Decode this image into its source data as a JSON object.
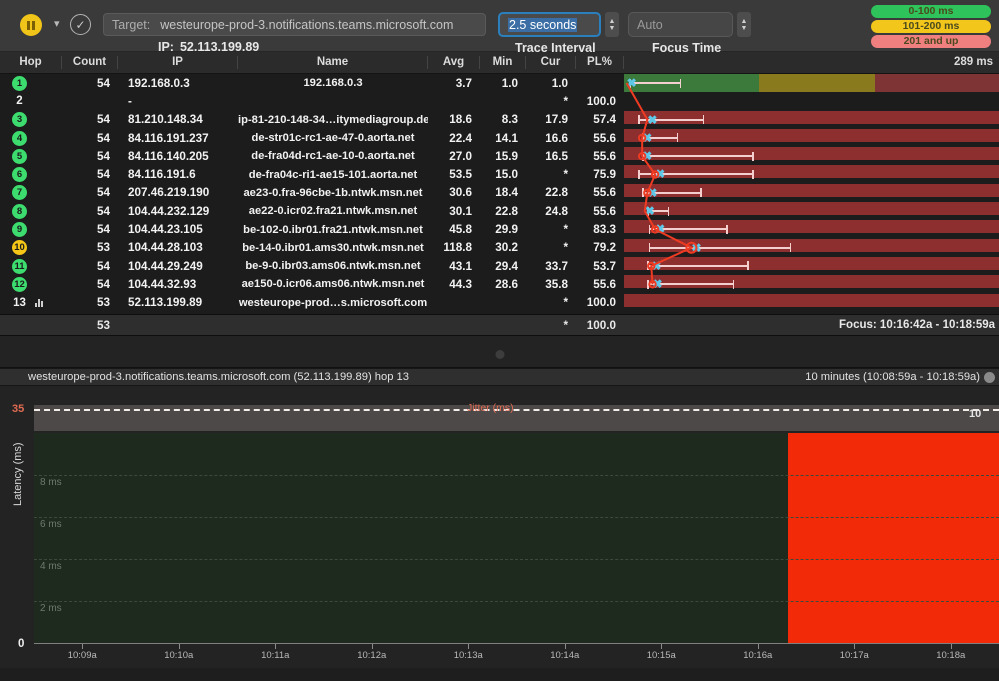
{
  "toolbar": {
    "pause_icon": "pause-icon",
    "chevron_icon": "chevron-down-icon",
    "check_icon": "✓",
    "target_label": "Target:",
    "target_value": "westeurope-prod-3.notifications.teams.microsoft.com",
    "ip_label": "IP:",
    "ip_value": "52.113.199.89",
    "trace_interval_value": "2.5 seconds",
    "trace_interval_caption": "Trace Interval",
    "focus_time_value": "Auto",
    "focus_time_caption": "Focus Time",
    "legend": [
      {
        "label": "0-100 ms",
        "color": "#2fc35c"
      },
      {
        "label": "101-200 ms",
        "color": "#f3c61c"
      },
      {
        "label": "201 and up",
        "color": "#f08080"
      }
    ]
  },
  "table": {
    "headers": {
      "hop": "Hop",
      "count": "Count",
      "ip": "IP",
      "name": "Name",
      "avg": "Avg",
      "min": "Min",
      "cur": "Cur",
      "pl": "PL%",
      "graph_scale": "289 ms"
    },
    "rows": [
      {
        "hop": "1",
        "bubble": "green",
        "count": "54",
        "ip": "192.168.0.3",
        "name": "192.168.0.3",
        "avg": "3.7",
        "min": "1.0",
        "cur": "1.0",
        "pl": ""
      },
      {
        "hop": "2",
        "bubble": "plain",
        "count": "",
        "ip": "-",
        "name": "",
        "avg": "",
        "min": "",
        "cur": "*",
        "pl": "100.0"
      },
      {
        "hop": "3",
        "bubble": "green",
        "count": "54",
        "ip": "81.210.148.34",
        "name": "ip-81-210-148-34…itymediagroup.de",
        "avg": "18.6",
        "min": "8.3",
        "cur": "17.9",
        "pl": "57.4"
      },
      {
        "hop": "4",
        "bubble": "green",
        "count": "54",
        "ip": "84.116.191.237",
        "name": "de-str01c-rc1-ae-47-0.aorta.net",
        "avg": "22.4",
        "min": "14.1",
        "cur": "16.6",
        "pl": "55.6"
      },
      {
        "hop": "5",
        "bubble": "green",
        "count": "54",
        "ip": "84.116.140.205",
        "name": "de-fra04d-rc1-ae-10-0.aorta.net",
        "avg": "27.0",
        "min": "15.9",
        "cur": "16.5",
        "pl": "55.6"
      },
      {
        "hop": "6",
        "bubble": "green",
        "count": "54",
        "ip": "84.116.191.6",
        "name": "de-fra04c-ri1-ae15-101.aorta.net",
        "avg": "53.5",
        "min": "15.0",
        "cur": "*",
        "pl": "75.9"
      },
      {
        "hop": "7",
        "bubble": "green",
        "count": "54",
        "ip": "207.46.219.190",
        "name": "ae23-0.fra-96cbe-1b.ntwk.msn.net",
        "avg": "30.6",
        "min": "18.4",
        "cur": "22.8",
        "pl": "55.6"
      },
      {
        "hop": "8",
        "bubble": "green",
        "count": "54",
        "ip": "104.44.232.129",
        "name": "ae22-0.icr02.fra21.ntwk.msn.net",
        "avg": "30.1",
        "min": "22.8",
        "cur": "24.8",
        "pl": "55.6"
      },
      {
        "hop": "9",
        "bubble": "green",
        "count": "54",
        "ip": "104.44.23.105",
        "name": "be-102-0.ibr01.fra21.ntwk.msn.net",
        "avg": "45.8",
        "min": "29.9",
        "cur": "*",
        "pl": "83.3"
      },
      {
        "hop": "10",
        "bubble": "yellow",
        "count": "53",
        "ip": "104.44.28.103",
        "name": "be-14-0.ibr01.ams30.ntwk.msn.net",
        "avg": "118.8",
        "min": "30.2",
        "cur": "*",
        "pl": "79.2"
      },
      {
        "hop": "11",
        "bubble": "green",
        "count": "54",
        "ip": "104.44.29.249",
        "name": "be-9-0.ibr03.ams06.ntwk.msn.net",
        "avg": "43.1",
        "min": "29.4",
        "cur": "33.7",
        "pl": "53.7"
      },
      {
        "hop": "12",
        "bubble": "green",
        "count": "54",
        "ip": "104.44.32.93",
        "name": "ae150-0.icr06.ams06.ntwk.msn.net",
        "avg": "44.3",
        "min": "28.6",
        "cur": "35.8",
        "pl": "55.6"
      },
      {
        "hop": "13",
        "bubble": "plain",
        "count": "53",
        "ip": "52.113.199.89",
        "name": "westeurope-prod…s.microsoft.com",
        "avg": "",
        "min": "",
        "cur": "*",
        "pl": "100.0",
        "sparkline": true
      }
    ],
    "summary": {
      "count": "53",
      "cur": "*",
      "pl": "100.0",
      "focus": "Focus: 10:16:42a - 10:18:59a"
    }
  },
  "chart_header": {
    "title": "westeurope-prod-3.notifications.teams.microsoft.com (52.113.199.89) hop 13",
    "range": "10 minutes (10:08:59a - 10:18:59a)",
    "gear_icon": "gear-icon"
  },
  "chart_data": {
    "type": "line",
    "title": "westeurope-prod-3.notifications.teams.microsoft.com (52.113.199.89) hop 13",
    "ylabel": "Latency (ms)",
    "ylim": [
      0,
      10
    ],
    "ytick_labels": [
      "0",
      "10"
    ],
    "gridlines": [
      "2 ms",
      "4 ms",
      "6 ms",
      "8 ms"
    ],
    "grid": true,
    "jitter_label": "Jitter (ms)",
    "jitter_max": "35",
    "xlabel": "",
    "x_ticks": [
      "10:09a",
      "10:10a",
      "10:11a",
      "10:12a",
      "10:13a",
      "10:14a",
      "10:15a",
      "10:16a",
      "10:17a",
      "10:18a"
    ],
    "series": [
      {
        "name": "latency",
        "values": []
      }
    ],
    "packet_loss_region": {
      "start_fraction": 0.782,
      "end_fraction": 1.0,
      "color": "#f32a07"
    },
    "legend_position": "none"
  },
  "graph_bands": {
    "green_end_pct": 36,
    "yellow_end_pct": 67,
    "green": "#3c7a3c",
    "yellow": "#8a7a1e",
    "red": "#7e3434",
    "row_red": "#8e2f2f",
    "line": "#ee3b22"
  },
  "graph_rows": [
    {
      "hop": 1,
      "x": 2,
      "bar_start": 4,
      "bar_end": 44,
      "band_row": false,
      "dot": false
    },
    {
      "hop": 2,
      "x": null,
      "bar_start": null,
      "bar_end": null,
      "band_row": false,
      "dot": false
    },
    {
      "hop": 3,
      "x": 18,
      "bar_start": 11,
      "bar_end": 62,
      "band_row": true,
      "dot": false
    },
    {
      "hop": 4,
      "x": 14,
      "bar_start": 14,
      "bar_end": 42,
      "band_row": true,
      "dot": true
    },
    {
      "hop": 5,
      "x": 14,
      "bar_start": 14,
      "bar_end": 100,
      "band_row": true,
      "dot": true
    },
    {
      "hop": 6,
      "x": 24,
      "bar_start": 11,
      "bar_end": 100,
      "band_row": true,
      "dot": true
    },
    {
      "hop": 7,
      "x": 18,
      "bar_start": 14,
      "bar_end": 60,
      "band_row": true,
      "dot": true
    },
    {
      "hop": 8,
      "x": 16,
      "bar_start": 18,
      "bar_end": 35,
      "band_row": true,
      "dot": false
    },
    {
      "hop": 9,
      "x": 24,
      "bar_start": 19,
      "bar_end": 80,
      "band_row": true,
      "dot": true
    },
    {
      "hop": 10,
      "x": 52,
      "bar_start": 19,
      "bar_end": 129,
      "band_row": true,
      "dot": true
    },
    {
      "hop": 11,
      "x": 21,
      "bar_start": 18,
      "bar_end": 96,
      "band_row": true,
      "dot": true
    },
    {
      "hop": 12,
      "x": 22,
      "bar_start": 18,
      "bar_end": 85,
      "band_row": true,
      "dot": true
    },
    {
      "hop": 13,
      "x": null,
      "bar_start": null,
      "bar_end": null,
      "band_row": true,
      "dot": false
    }
  ]
}
